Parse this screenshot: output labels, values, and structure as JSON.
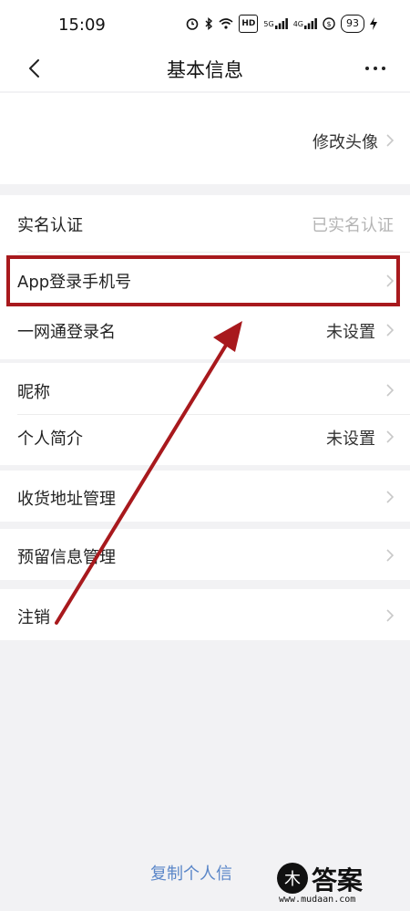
{
  "status_bar": {
    "time": "15:09",
    "net_badge": "HD",
    "signal1": "5G",
    "signal2": "4G",
    "battery": "93"
  },
  "nav": {
    "title": "基本信息"
  },
  "avatar_section": {
    "change_avatar": "修改头像"
  },
  "rows": {
    "real_name": {
      "label": "实名认证",
      "value": "已实名认证"
    },
    "app_phone": {
      "label": "App登录手机号"
    },
    "login_name": {
      "label": "一网通登录名",
      "value": "未设置"
    },
    "nickname": {
      "label": "昵称"
    },
    "bio": {
      "label": "个人简介",
      "value": "未设置"
    },
    "address": {
      "label": "收货地址管理"
    },
    "reserved_info": {
      "label": "预留信息管理"
    },
    "cancel_account": {
      "label": "注销"
    }
  },
  "footer": {
    "copy_link": "复制个人信"
  },
  "watermark": {
    "text": "答案",
    "url": "www.mudaan.com"
  },
  "colors": {
    "highlight": "#a8191d",
    "link": "#5a86c8",
    "background": "#f2f2f4"
  }
}
